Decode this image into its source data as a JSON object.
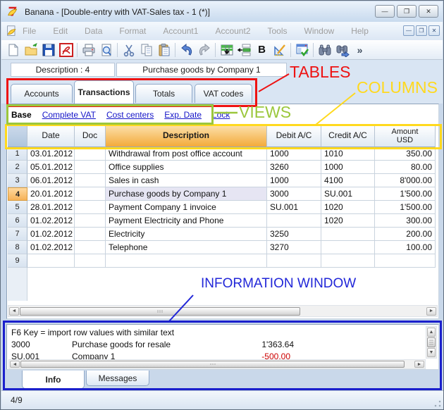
{
  "window": {
    "title": "Banana - [Double-entry with VAT-Sales tax - 1 (*)]",
    "controls": {
      "minimize": "—",
      "restore": "❐",
      "close": "✕"
    }
  },
  "menu": {
    "items": [
      "File",
      "Edit",
      "Data",
      "Format",
      "Account1",
      "Account2",
      "Tools",
      "Window",
      "Help"
    ],
    "mdi_controls": {
      "minimize": "—",
      "restore": "❐",
      "close": "✕"
    }
  },
  "toolbar": {
    "bold_label": "B",
    "more_label": "»",
    "icons": [
      "new-file",
      "open-file",
      "save",
      "pdf-export",
      "print",
      "print-preview",
      "cut",
      "copy",
      "paste",
      "undo",
      "redo",
      "insert-rows",
      "add-row",
      "bold",
      "recalculate",
      "check-accounting",
      "find",
      "find-next",
      "more"
    ]
  },
  "header_bar": {
    "field_label": "Description : 4",
    "field_value": "Purchase goods by Company 1"
  },
  "table_tabs": {
    "accounts": "Accounts",
    "transactions": "Transactions",
    "totals": "Totals",
    "vat_codes": "VAT codes"
  },
  "views": {
    "base": "Base",
    "complete_vat": "Complete VAT",
    "cost_centers": "Cost centers",
    "exp_date": "Exp. Date",
    "lock": "Lock"
  },
  "table": {
    "columns": {
      "date": "Date",
      "doc": "Doc",
      "description": "Description",
      "debit": "Debit A/C",
      "credit": "Credit A/C",
      "amount_line1": "Amount",
      "amount_line2": "USD"
    },
    "rows": [
      {
        "num": "1",
        "date": "03.01.2012",
        "doc": "",
        "description": "Withdrawal from post office account",
        "debit": "1000",
        "credit": "1010",
        "amount": "350.00",
        "selected": false
      },
      {
        "num": "2",
        "date": "05.01.2012",
        "doc": "",
        "description": "Office supplies",
        "debit": "3260",
        "credit": "1000",
        "amount": "80.00",
        "selected": false
      },
      {
        "num": "3",
        "date": "06.01.2012",
        "doc": "",
        "description": "Sales in cash",
        "debit": "1000",
        "credit": "4100",
        "amount": "8'000.00",
        "selected": false
      },
      {
        "num": "4",
        "date": "20.01.2012",
        "doc": "",
        "description": "Purchase goods by Company 1",
        "debit": "3000",
        "credit": "SU.001",
        "amount": "1'500.00",
        "selected": true
      },
      {
        "num": "5",
        "date": "28.01.2012",
        "doc": "",
        "description": "Payment Company 1 invoice",
        "debit": "SU.001",
        "credit": "1020",
        "amount": "1'500.00",
        "selected": false
      },
      {
        "num": "6",
        "date": "01.02.2012",
        "doc": "",
        "description": "Payment Electricity and Phone",
        "debit": "",
        "credit": "1020",
        "amount": "300.00",
        "selected": false
      },
      {
        "num": "7",
        "date": "01.02.2012",
        "doc": "",
        "description": "Electricity",
        "debit": "3250",
        "credit": "",
        "amount": "200.00",
        "selected": false
      },
      {
        "num": "8",
        "date": "01.02.2012",
        "doc": "",
        "description": "Telephone",
        "debit": "3270",
        "credit": "",
        "amount": "100.00",
        "selected": false
      },
      {
        "num": "9",
        "date": "",
        "doc": "",
        "description": "",
        "debit": "",
        "credit": "",
        "amount": "",
        "selected": false
      }
    ]
  },
  "info_panel": {
    "line1": "F6 Key = import row values with similar text",
    "rows": [
      {
        "code": "3000",
        "name": "Purchase goods for resale",
        "amount": "1'363.64",
        "negative": false
      },
      {
        "code": "SU.001",
        "name": "Company 1",
        "amount": "-500.00",
        "negative": true
      }
    ]
  },
  "bottom_tabs": {
    "info": "Info",
    "messages": "Messages"
  },
  "status_bar": {
    "position": "4/9"
  },
  "annotations": {
    "tables_label": "TABLES",
    "columns_label": "COLUMNS",
    "views_label": "VIEWS",
    "information_window_label": "INFORMATION WINDOW",
    "colors": {
      "red": "#ee1212",
      "yellow": "#ffd91e",
      "green": "#9bc73c",
      "blue": "#2126d8"
    }
  }
}
